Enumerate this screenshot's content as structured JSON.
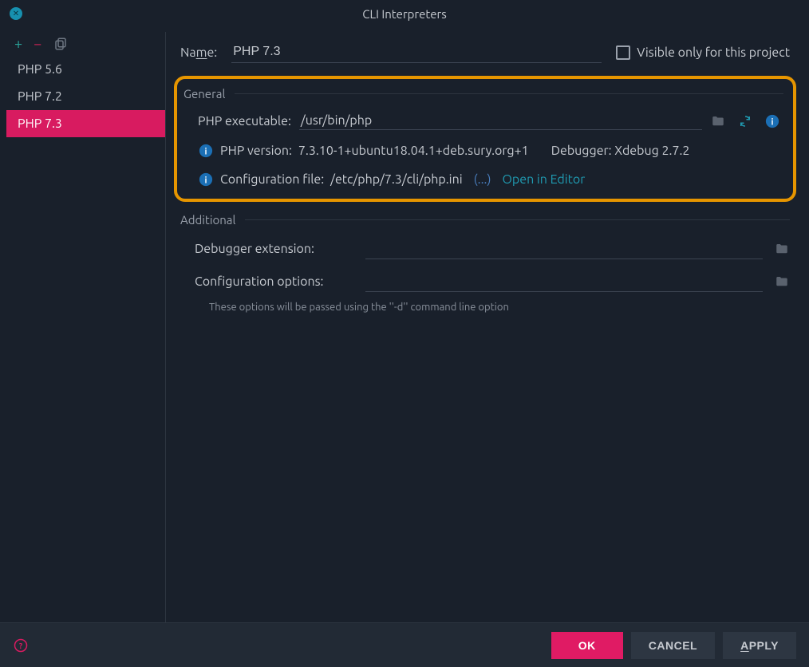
{
  "titlebar": {
    "title": "CLI Interpreters"
  },
  "sidebar": {
    "items": [
      {
        "label": "PHP 5.6"
      },
      {
        "label": "PHP 7.2"
      },
      {
        "label": "PHP 7.3"
      }
    ],
    "selected_index": 2
  },
  "name_row": {
    "label": "Name:",
    "value": "PHP 7.3",
    "visible_only_label": "Visible only for this project",
    "visible_only_checked": false
  },
  "general": {
    "section_title": "General",
    "executable_label": "PHP executable:",
    "executable_value": "/usr/bin/php",
    "version_label": "PHP version:",
    "version_value": "7.3.10-1+ubuntu18.04.1+deb.sury.org+1",
    "debugger_label": "Debugger:",
    "debugger_value": "Xdebug 2.7.2",
    "config_label": "Configuration file:",
    "config_value": "/etc/php/7.3/cli/php.ini",
    "ellipsis": "(...)",
    "open_in_editor": "Open in Editor"
  },
  "additional": {
    "section_title": "Additional",
    "debugger_ext_label": "Debugger extension:",
    "debugger_ext_value": "",
    "config_opts_label": "Configuration options:",
    "config_opts_value": "",
    "hint": "These options will be passed using the ''-d'' command line option"
  },
  "footer": {
    "ok": "OK",
    "cancel": "CANCEL",
    "apply": "APPLY"
  }
}
